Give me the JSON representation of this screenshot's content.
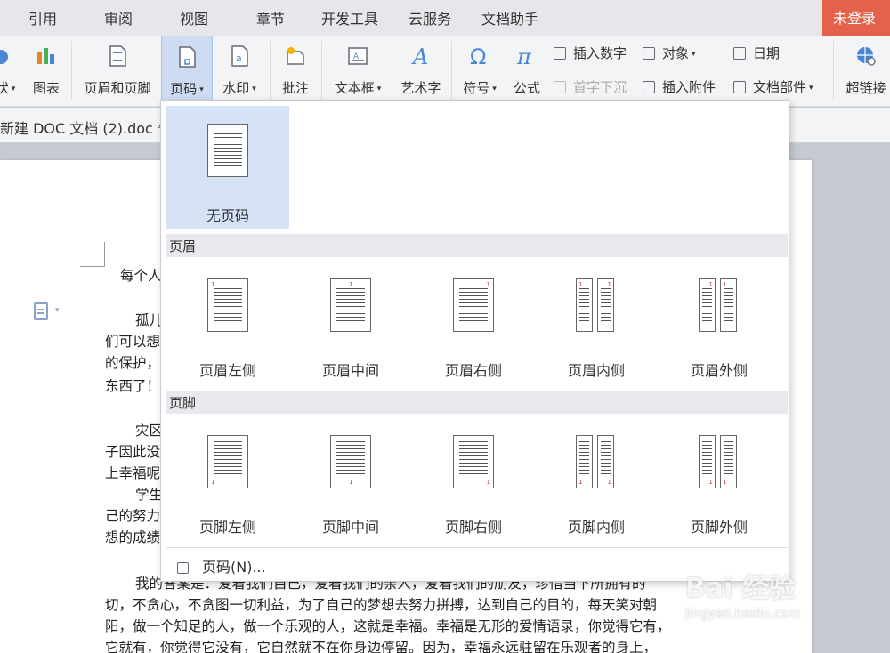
{
  "menu": {
    "items": [
      "引用",
      "审阅",
      "视图",
      "章节",
      "开发工具",
      "云服务",
      "文档助手"
    ],
    "login": "未登录"
  },
  "ribbon": {
    "shape_partial": "状",
    "chart": "图表",
    "header_footer": "页眉和页脚",
    "page_number": "页码",
    "watermark": "水印",
    "comment": "批注",
    "textbox": "文本框",
    "wordart": "艺术字",
    "symbol": "符号",
    "formula": "公式",
    "insert_number": "插入数字",
    "object": "对象",
    "date": "日期",
    "drop_cap": "首字下沉",
    "insert_attachment": "插入附件",
    "doc_parts": "文档部件",
    "hyperlink": "超链接"
  },
  "doc_tab": {
    "title": "新建 DOC 文档 (2).doc *"
  },
  "document": {
    "lines": [
      "每个人",
      "孤儿",
      "们可以想",
      "的保护，",
      "东西了！",
      "灾区",
      "子因此没",
      "上幸福呢",
      "学生",
      "己的努力",
      "想的成绩",
      "我的答案是：爱着我们自己，爱着我们的亲人，爱着我们的朋友，珍惜当下所拥有的",
      "切，不贪心，不贪图一切利益，为了自己的梦想去努力拼搏，达到自己的目的，每天笑对朝",
      "阳，做一个知足的人，做一个乐观的人，这就是幸福。幸福是无形的爱情语录，你觉得它有，",
      "它就有，你觉得它没有，它自然就不在你身边停留。因为，幸福永远驻留在乐观者的身上，"
    ]
  },
  "dropdown": {
    "no_page_number": "无页码",
    "header_section": "页眉",
    "header_options": [
      "页眉左侧",
      "页眉中间",
      "页眉右侧",
      "页眉内侧",
      "页眉外侧"
    ],
    "footer_section": "页脚",
    "footer_options": [
      "页脚左侧",
      "页脚中间",
      "页脚右侧",
      "页脚内侧",
      "页脚外侧"
    ],
    "page_number_dialog": "页码(N)...",
    "thumb_number": "1"
  },
  "watermark_logo": {
    "text": "Bai 经验",
    "url": "jingyan.baidu.com"
  }
}
